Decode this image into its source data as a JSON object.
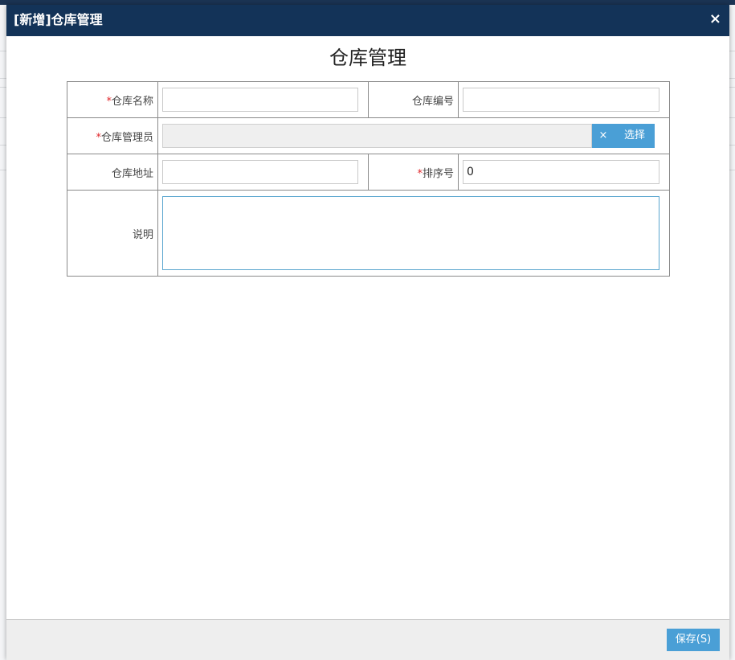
{
  "dialog": {
    "title": "[新增]仓库管理",
    "close_icon": "×"
  },
  "form": {
    "title": "仓库管理",
    "required_mark": "*",
    "fields": {
      "name": {
        "label": "仓库名称",
        "value": "",
        "required": true
      },
      "code": {
        "label": "仓库编号",
        "value": "",
        "required": false
      },
      "manager": {
        "label": "仓库管理员",
        "value": "",
        "required": true,
        "clear_label": "×",
        "choose_label": "选择"
      },
      "address": {
        "label": "仓库地址",
        "value": "",
        "required": false
      },
      "sort": {
        "label": "排序号",
        "value": "0",
        "required": true
      },
      "remark": {
        "label": "说明",
        "value": "",
        "required": false
      }
    }
  },
  "footer": {
    "save_label": "保存(S)"
  },
  "colors": {
    "titlebar": "#133358",
    "accent": "#4a9fd6",
    "required": "#e0262a"
  }
}
